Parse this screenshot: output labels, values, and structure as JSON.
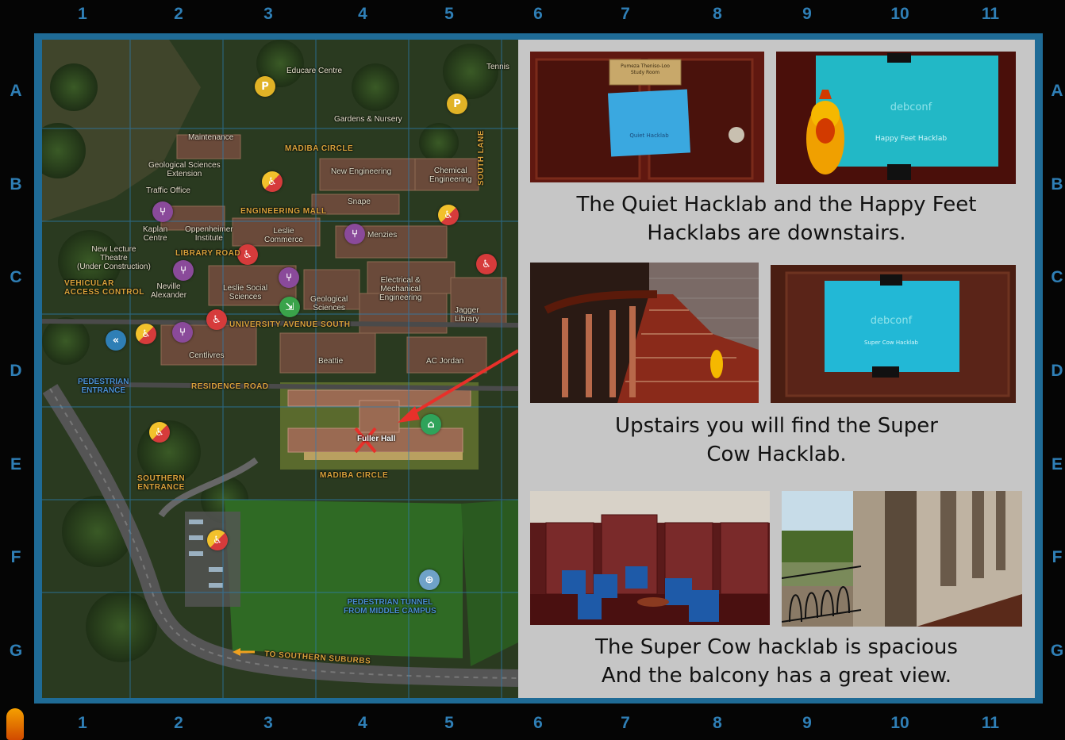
{
  "grid": {
    "columns": [
      "1",
      "2",
      "3",
      "4",
      "5",
      "6",
      "7",
      "8",
      "9",
      "10",
      "11"
    ],
    "rows": [
      "A",
      "B",
      "C",
      "D",
      "E",
      "F",
      "G"
    ]
  },
  "map": {
    "labels": {
      "educare": "Educare Centre",
      "tennis": "Tennis",
      "gardens": "Gardens & Nursery",
      "maintenance": "Maintenance",
      "madiba_top": "MADIBA CIRCLE",
      "geo_ext": "Geological Sciences\nExtension",
      "new_eng": "New Engineering",
      "chem_eng": "Chemical\nEngineering",
      "south_lane": "SOUTH LANE",
      "traffic": "Traffic Office",
      "snape": "Snape",
      "eng_mall": "ENGINEERING MALL",
      "kaplan": "Kaplan\nCentre",
      "oppenheimer": "Oppenheimer\nInstitute",
      "leslie_commerce": "Leslie\nCommerce",
      "menzies": "Menzies",
      "new_lecture": "New Lecture\nTheatre\n(Under Construction)",
      "library_road": "LIBRARY ROAD",
      "neville": "Neville\nAlexander",
      "leslie_social": "Leslie Social\nSciences",
      "geo_sci": "Geological\nSciences",
      "electrical": "Electrical &\nMechanical\nEngineering",
      "jagger": "Jagger\nLibrary",
      "vehicular": "VEHICULAR\nACCESS CONTROL",
      "univ_ave": "UNIVERSITY AVENUE SOUTH",
      "centlivres": "Centlivres",
      "beattie": "Beattie",
      "ac_jordan": "AC Jordan",
      "ped_entrance": "PEDESTRIAN\nENTRANCE",
      "residence_road": "RESIDENCE ROAD",
      "fuller": "Fuller Hall",
      "madiba_bottom": "MADIBA CIRCLE",
      "southern_entrance": "SOUTHERN\nENTRANCE",
      "ped_tunnel": "PEDESTRIAN TUNNEL\nFROM MIDDLE CAMPUS",
      "to_southern": "TO SOUTHERN SUBURBS"
    },
    "colors": {
      "road_label": "#d9a23b",
      "marker": "#e8302a",
      "grid": "#1f6b96"
    }
  },
  "panel": {
    "captions": [
      "The Quiet Hacklab and the Happy Feet\nHacklabs are downstairs.",
      "Upstairs you will find the Super\nCow Hacklab.",
      "The Super Cow hacklab is spacious\nAnd the balcony has a great view."
    ],
    "photo_text": {
      "plaque": "Pumeza Theniso-Loo\nStudy Room",
      "quiet_sign": "Quiet Hacklab",
      "happy_sign": "Happy Feet Hacklab",
      "supercow_sign": "Super Cow Hacklab",
      "debconf": "debconf"
    }
  }
}
